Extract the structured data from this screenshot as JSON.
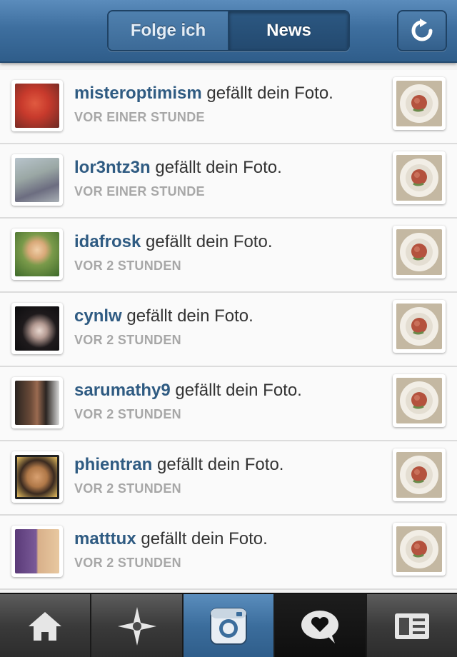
{
  "header": {
    "segments": [
      {
        "label": "Folge ich",
        "active": false
      },
      {
        "label": "News",
        "active": true
      }
    ],
    "refresh_icon": "refresh-icon"
  },
  "feed": {
    "items": [
      {
        "username": "misteroptimism",
        "action": "gefällt dein Foto.",
        "time": "VOR EINER STUNDE"
      },
      {
        "username": "lor3ntz3n",
        "action": "gefällt dein Foto.",
        "time": "VOR EINER STUNDE"
      },
      {
        "username": "idafrosk",
        "action": "gefällt dein Foto.",
        "time": "VOR 2 STUNDEN"
      },
      {
        "username": "cynlw",
        "action": "gefällt dein Foto.",
        "time": "VOR 2 STUNDEN"
      },
      {
        "username": "sarumathy9",
        "action": "gefällt dein Foto.",
        "time": "VOR 2 STUNDEN"
      },
      {
        "username": "phientran",
        "action": "gefällt dein Foto.",
        "time": "VOR 2 STUNDEN"
      },
      {
        "username": "matttux",
        "action": "gefällt dein Foto.",
        "time": "VOR 2 STUNDEN"
      }
    ]
  },
  "tabbar": {
    "tabs": [
      {
        "icon": "home-icon",
        "active": false
      },
      {
        "icon": "explore-star-icon",
        "active": false
      },
      {
        "icon": "camera-icon",
        "active": true
      },
      {
        "icon": "news-heart-bubble-icon",
        "active": false
      },
      {
        "icon": "profile-card-icon",
        "active": false
      }
    ]
  },
  "colors": {
    "header_blue": "#3e6f9f",
    "username_blue": "#2f5b82",
    "time_gray": "#a7a7a7",
    "active_tab_blue": "#3b6d9c"
  }
}
